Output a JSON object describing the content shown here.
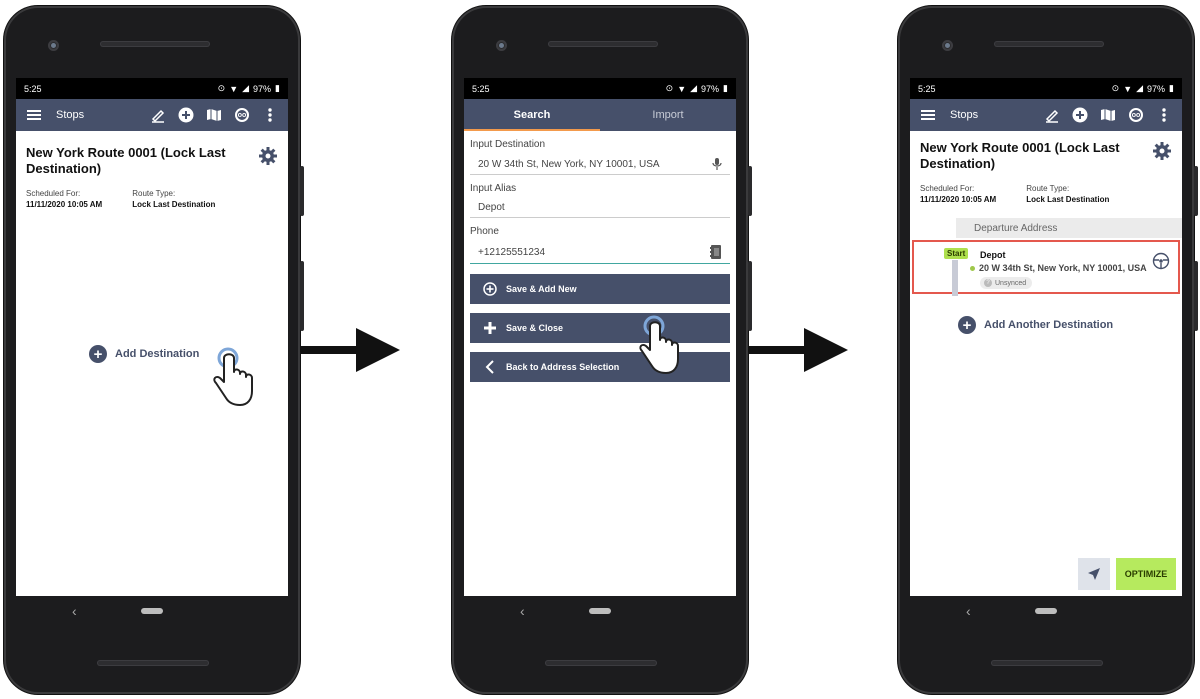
{
  "status": {
    "time": "5:25",
    "battery": "97%"
  },
  "screen1": {
    "appbar_title": "Stops",
    "route_title": "New York Route 0001 (Lock Last Destination)",
    "scheduled_label": "Scheduled For:",
    "scheduled_value": "11/11/2020  10:05 AM",
    "route_type_label": "Route Type:",
    "route_type_value": "Lock Last Destination",
    "add_destination": "Add Destination"
  },
  "screen2": {
    "tabs": [
      "Search",
      "Import"
    ],
    "input_destination_label": "Input Destination",
    "input_destination_value": "20 W 34th St, New York, NY 10001, USA",
    "input_alias_label": "Input Alias",
    "input_alias_value": "Depot",
    "phone_label": "Phone",
    "phone_value": "+12125551234",
    "buttons": [
      "Save & Add New",
      "Save & Close",
      "Back to Address Selection"
    ]
  },
  "screen3": {
    "appbar_title": "Stops",
    "route_title": "New York Route 0001 (Lock Last Destination)",
    "scheduled_label": "Scheduled For:",
    "scheduled_value": "11/11/2020  10:05 AM",
    "route_type_label": "Route Type:",
    "route_type_value": "Lock Last Destination",
    "departure_header": "Departure Address",
    "start_tag": "Start",
    "stop_name": "Depot",
    "stop_address": "20 W 34th St, New York, NY 10001, USA",
    "sync_status": "Unsynced",
    "add_another": "Add Another Destination",
    "optimize": "OPTIMIZE"
  },
  "colors": {
    "appbar": "#46506a",
    "accent_tab": "#f39a4c",
    "optimize": "#b6ea5e",
    "highlight": "#e4584d",
    "start": "#aee04e"
  }
}
